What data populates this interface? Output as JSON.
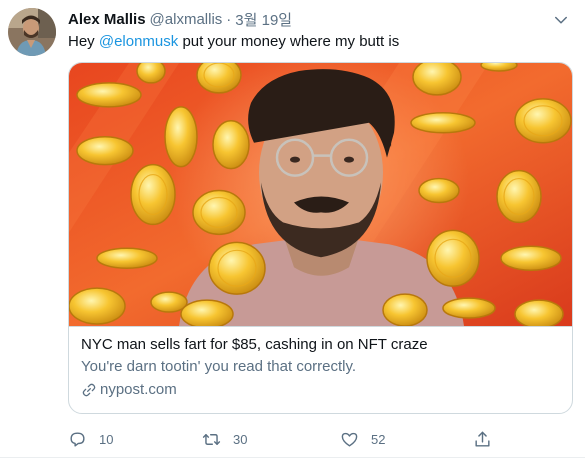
{
  "tweet": {
    "author_name": "Alex Mallis",
    "handle": "@alxmallis",
    "separator": "·",
    "date": "3월 19일",
    "text_before": "Hey ",
    "mention": "@elonmusk",
    "text_after": " put your money where my butt is"
  },
  "card": {
    "title": "NYC man sells fart for $85, cashing in on NFT craze",
    "description": "You're darn tootin' you read that correctly.",
    "domain": "nypost.com"
  },
  "actions": {
    "replies": "10",
    "retweets": "30",
    "likes": "52"
  },
  "colors": {
    "link": "#1b95e0",
    "secondary_text": "#5b7083",
    "border": "#cfd9de",
    "card_bg_orange": "#f0622a"
  },
  "icons": [
    "more-icon",
    "link-icon",
    "reply-icon",
    "retweet-icon",
    "like-icon",
    "share-icon"
  ]
}
